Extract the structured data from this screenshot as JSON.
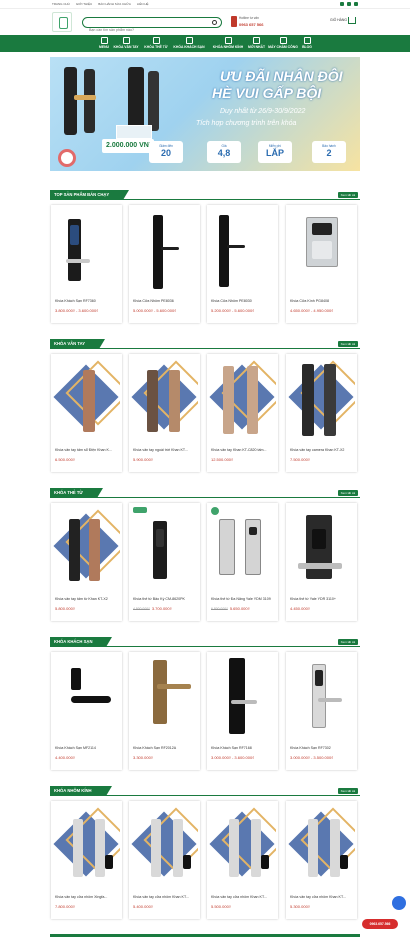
{
  "topbar": {
    "links": [
      "TRANG CHỦ",
      "GIỚI THIỆU",
      "BẢO HÀNH SỬA CHỮA",
      "LIÊN HỆ"
    ]
  },
  "header": {
    "search_placeholder": "Bạn cần tìm sản phẩm nào?",
    "hotline_label": "Hotline tư vấn",
    "hotline_number": "0963 657 566",
    "cart_label": "GIỎ HÀNG"
  },
  "nav": {
    "items": [
      "MENU",
      "KHÓA VÂN TAY",
      "KHÓA THẺ TỪ",
      "KHÓA KHÁCH SẠN",
      "KHÓA NHÔM KÍNH",
      "MỚI NHẤT",
      "MÁY CHẤM CÔNG",
      "BLOG"
    ]
  },
  "banner": {
    "headline1": "ƯU ĐÃI NHÂN ĐÔI",
    "headline2": "HÈ VUI GẤP BỘI",
    "subline1": "Duy nhất từ 26/9-30/9/2022",
    "subline2": "Tích hợp chương trình trên khóa",
    "money": "2.000.000 VNĐ",
    "badges": [
      {
        "small": "Giảm đến",
        "big": "20"
      },
      {
        "small": "Giá",
        "big": "4,8"
      },
      {
        "small": "Miễn phí",
        "big": "LẮP"
      },
      {
        "small": "Bảo hành",
        "big": "2"
      }
    ]
  },
  "sections": [
    {
      "title": "TOP SẢN PHẨM BÁN CHẠY",
      "more": "Xem tất cả",
      "products": [
        {
          "name": "Khóa Khách Sạn RF7360",
          "price": "3.800.000₫ - 3.600.000₫",
          "old": ""
        },
        {
          "name": "Khóa Cửa Nhôm PE8036",
          "price": "5.000.000₫ - 5.600.000₫",
          "old": ""
        },
        {
          "name": "Khóa Cửa Nhôm PE8030",
          "price": "5.200.000₫ - 5.600.000₫",
          "old": ""
        },
        {
          "name": "Khóa Cửa Kính PG8408",
          "price": "4.650.000₫ - 4.950.000₫",
          "old": ""
        }
      ]
    },
    {
      "title": "KHÓA VÂN TAY",
      "more": "Xem tất cả",
      "products": [
        {
          "name": "Khóa vân tay tấm sổ Điện Khan K...",
          "price": "6.500.000₫",
          "old": ""
        },
        {
          "name": "Khóa vân tay ngoài trời Khan KT...",
          "price": "5.900.000₫",
          "old": ""
        },
        {
          "name": "Khóa vân tay Khan KT-C820 tấm...",
          "price": "12.500.000₫",
          "old": ""
        },
        {
          "name": "Khóa vân tay camera Khan KT-X2",
          "price": "7.500.000₫",
          "old": ""
        }
      ]
    },
    {
      "title": "KHÓA THẺ TỪ",
      "more": "Xem tất cả",
      "products": [
        {
          "name": "Khóa vân tay tấm từ Khan KT-X2",
          "price": "5.800.000₫",
          "old": ""
        },
        {
          "name": "Khóa thẻ từ Bảo Kỳ CM-8620PK",
          "price": "3.700.000₫",
          "old": "4.900.000₫"
        },
        {
          "name": "Khóa thẻ từ Đa Năng Yale YDM 3109",
          "price": "5.650.000₫",
          "old": "6.800.000₫"
        },
        {
          "name": "Khóa thẻ từ Yale YDR 3110+",
          "price": "4.450.000₫",
          "old": ""
        }
      ]
    },
    {
      "title": "KHÓA KHÁCH SẠN",
      "more": "Xem tất cả",
      "products": [
        {
          "name": "Khóa Khách Sạn MF2114",
          "price": "4.400.000₫",
          "old": ""
        },
        {
          "name": "Khóa Khách Sạn RF2012A",
          "price": "3.300.000₫",
          "old": ""
        },
        {
          "name": "Khóa Khách Sạn RF7168",
          "price": "3.000.000₫ - 3.600.000₫",
          "old": ""
        },
        {
          "name": "Khóa Khách Sạn RF7302",
          "price": "3.000.000₫ - 3.500.000₫",
          "old": ""
        }
      ]
    },
    {
      "title": "KHÓA NHÔM KÍNH",
      "more": "Xem tất cả",
      "products": [
        {
          "name": "Khóa vân tay cửa nhôm Xingfa...",
          "price": "7.800.000₫",
          "old": ""
        },
        {
          "name": "Khóa vân tay cửa nhôm Khan KT...",
          "price": "5.400.000₫",
          "old": ""
        },
        {
          "name": "Khóa vân tay cửa nhôm Khan KT...",
          "price": "5.500.000₫",
          "old": ""
        },
        {
          "name": "Khóa vân tay cửa nhôm Khan KT...",
          "price": "5.300.000₫",
          "old": ""
        }
      ]
    }
  ],
  "float": {
    "hotline_button": "0963.657.566"
  }
}
